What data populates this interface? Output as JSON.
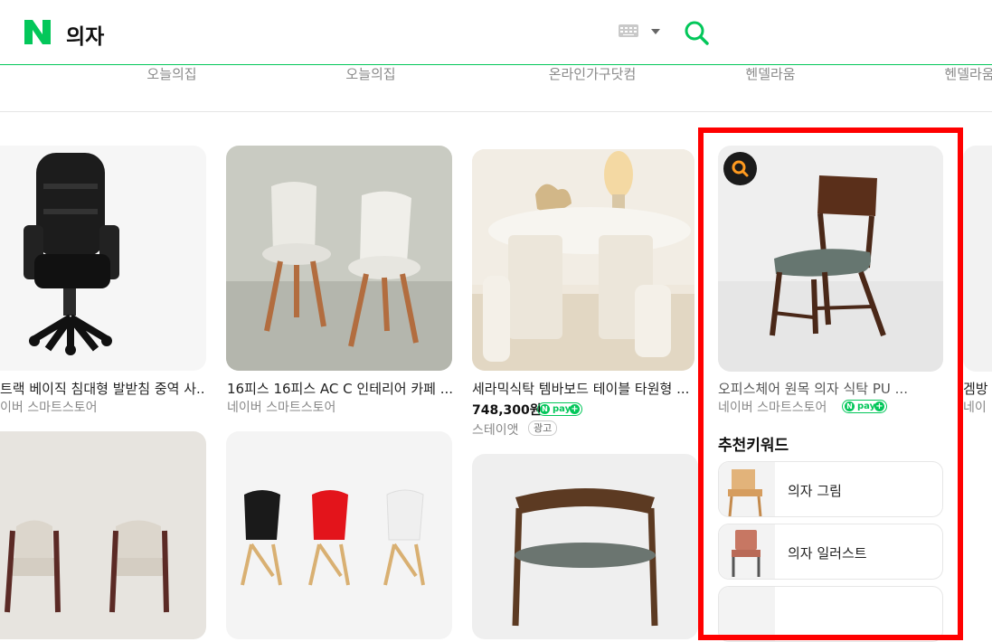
{
  "search": {
    "query": "의자"
  },
  "shops": [
    "오늘의집",
    "오늘의집",
    "온라인가구닷컴",
    "헨델라움",
    "헨델라움"
  ],
  "products": [
    {
      "title": "트랙 베이직 침대형 발받침 중역 사...",
      "seller": "이버 스마트스토어"
    },
    {
      "title": "16피스 16피스 AC C 인테리어 카페 ...",
      "seller": "네이버 스마트스토어"
    },
    {
      "title": "세라믹식탁 템바보드 테이블 타원형 ...",
      "price": "748,300원",
      "seller": "스테이앳",
      "ad": "광고"
    },
    {
      "title": "오피스체어 원목 의자 식탁 PU ...",
      "seller": "네이버 스마트스토어"
    },
    {
      "title": "겜방",
      "seller": "네이"
    }
  ],
  "npay_label": "pay",
  "npay_n": "N",
  "npay_plus": "+",
  "keywords": {
    "title": "추천키워드",
    "items": [
      "의자 그림",
      "의자 일러스트",
      ""
    ]
  },
  "colors": {
    "brand": "#03c75a",
    "highlight": "#ff0000"
  },
  "icons": [
    "naver-logo-icon",
    "keyboard-icon",
    "search-icon",
    "lens-search-icon"
  ]
}
